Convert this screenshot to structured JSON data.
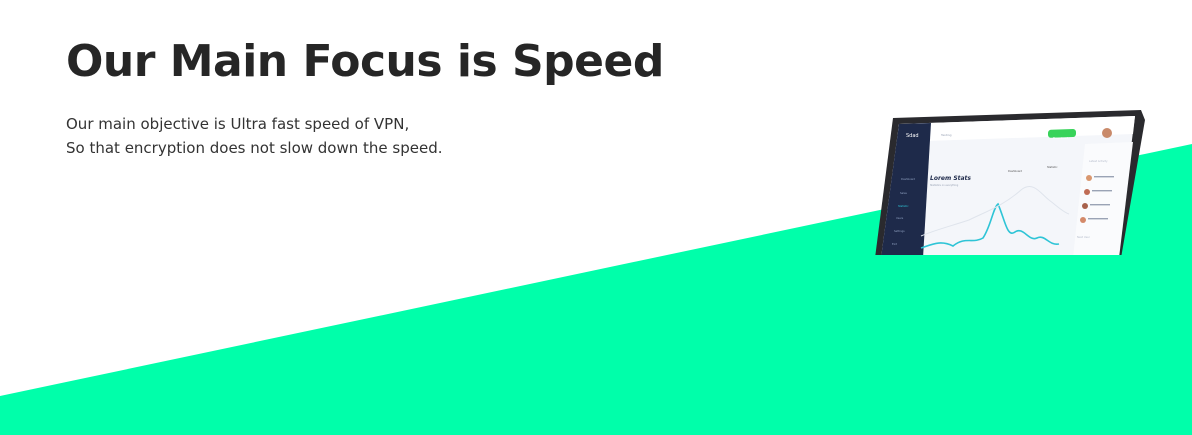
{
  "hero": {
    "title": "Our Main Focus is Speed",
    "description_line1": "Our main objective is Ultra fast speed of VPN,",
    "description_line2": "So that encryption does not slow down the speed."
  },
  "colors": {
    "accent_green": "#00FFAA",
    "title_text": "#262626",
    "body_text": "#333333",
    "dashboard_sidebar": "#1E2A4A",
    "chart_line": "#2EC4D6"
  },
  "laptop_screen": {
    "brand": "Sdad",
    "search_placeholder": "Testing",
    "action_button": "Download",
    "stats_title": "Lorem Stats",
    "stats_subtitle": "Statistics on everything",
    "filter_1": "Dashboard",
    "filter_2": "Statistic",
    "side_panel_title": "Latest Activity",
    "side_panel_title_2": "Next User",
    "nav_items": [
      "Dashboard",
      "Sales",
      "Statistic",
      "Users",
      "Settings",
      "Exit"
    ]
  }
}
